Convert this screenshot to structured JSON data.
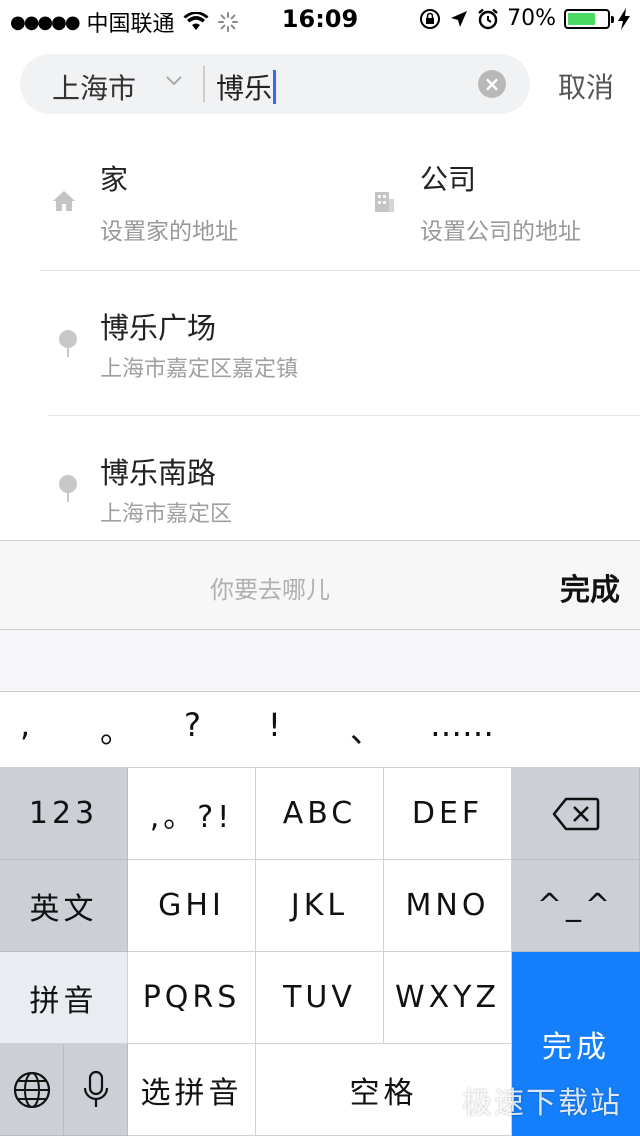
{
  "status_bar": {
    "carrier": "中国联通",
    "time": "16:09",
    "battery": "70%",
    "battery_level": 0.7
  },
  "search": {
    "city": "上海市",
    "query": "博乐",
    "cancel_label": "取消"
  },
  "shortcuts": {
    "home": {
      "title": "家",
      "subtitle": "设置家的地址"
    },
    "company": {
      "title": "公司",
      "subtitle": "设置公司的地址"
    }
  },
  "results": [
    {
      "name": "博乐广场",
      "address": "上海市嘉定区嘉定镇"
    },
    {
      "name": "博乐南路",
      "address": "上海市嘉定区"
    }
  ],
  "accessory": {
    "placeholder": "你要去哪儿",
    "done_label": "完成"
  },
  "punctuation": [
    ",",
    "。",
    "?",
    "!",
    "、",
    "……"
  ],
  "keyboard": {
    "num": "123",
    "symbols": ",。?!",
    "abc": "ABC",
    "def": "DEF",
    "english": "英文",
    "ghi": "GHI",
    "jkl": "JKL",
    "mno": "MNO",
    "emoji": "^_^",
    "pinyin": "拼音",
    "pqrs": "PQRS",
    "tuv": "TUV",
    "wxyz": "WXYZ",
    "select_pinyin": "选拼音",
    "space": "空格",
    "done": "完成"
  },
  "watermark": "极速下载站"
}
